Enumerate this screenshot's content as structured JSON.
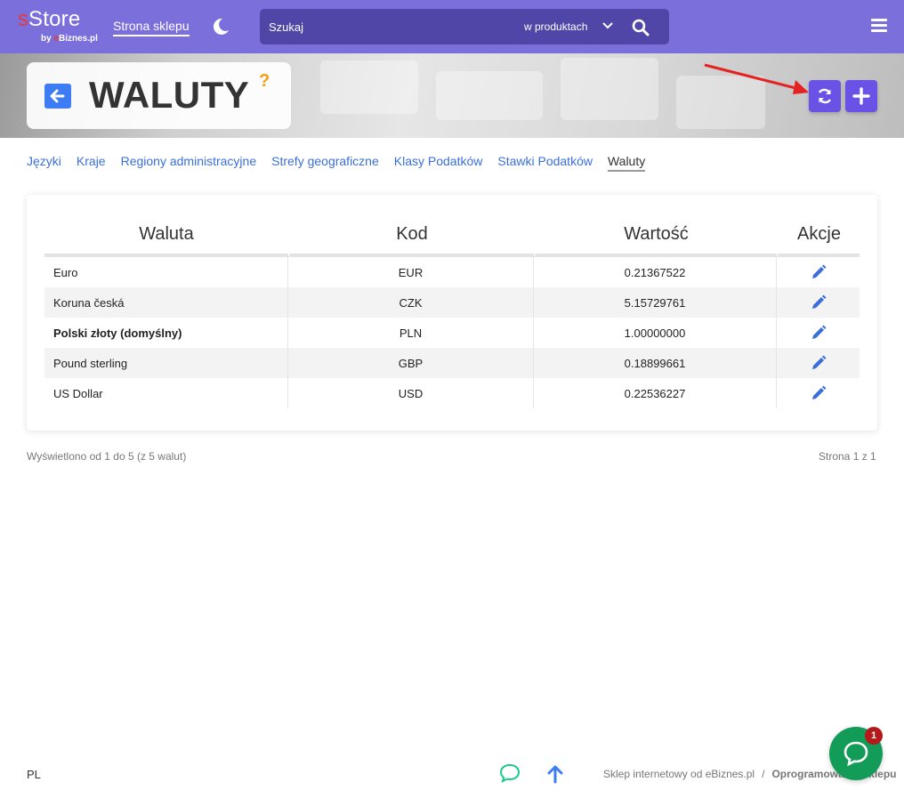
{
  "header": {
    "logo": {
      "prefix": "s",
      "name": "Store",
      "by": "by",
      "by_brand_prefix": "e",
      "by_brand": "Biznes.pl"
    },
    "shop_link": "Strona sklepu",
    "search": {
      "placeholder": "Szukaj",
      "scope": "w produktach"
    }
  },
  "page": {
    "title": "WALUTY",
    "help": "?"
  },
  "tabs": [
    {
      "label": "Języki"
    },
    {
      "label": "Kraje"
    },
    {
      "label": "Regiony administracyjne"
    },
    {
      "label": "Strefy geograficzne"
    },
    {
      "label": "Klasy Podatków"
    },
    {
      "label": "Stawki Podatków"
    },
    {
      "label": "Waluty",
      "active": true
    }
  ],
  "table": {
    "columns": [
      "Waluta",
      "Kod",
      "Wartość",
      "Akcje"
    ],
    "rows": [
      {
        "name": "Euro",
        "code": "EUR",
        "value": "0.21367522",
        "bold": false
      },
      {
        "name": "Koruna česká",
        "code": "CZK",
        "value": "5.15729761",
        "bold": false
      },
      {
        "name": "Polski złoty (domyślny)",
        "code": "PLN",
        "value": "1.00000000",
        "bold": true
      },
      {
        "name": "Pound sterling",
        "code": "GBP",
        "value": "0.18899661",
        "bold": false
      },
      {
        "name": "US Dollar",
        "code": "USD",
        "value": "0.22536227",
        "bold": false
      }
    ]
  },
  "pagination": {
    "summary": "Wyświetlono od 1 do 5 (z 5 walut)",
    "page": "Strona 1 z 1"
  },
  "footer": {
    "lang": "PL",
    "credit": "Sklep internetowy od eBiznes.pl",
    "separator": "/",
    "software": "Oprogramowanie sklepu"
  },
  "chat": {
    "badge": "1"
  },
  "colors": {
    "topbar": "#7b6fdc",
    "search_bg": "#4f46a8",
    "accent": "#6a52e6",
    "link": "#3b6fd6",
    "back_button": "#3d7cf5",
    "help": "#f59e0b",
    "chat": "#139b58",
    "badge": "#b51a1a"
  }
}
